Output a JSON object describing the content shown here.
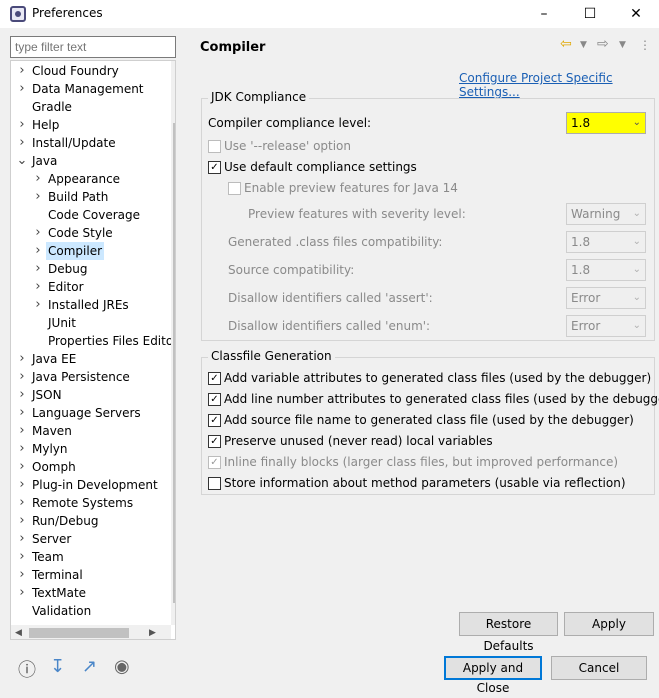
{
  "window": {
    "title": "Preferences",
    "icon": "preferences-icon",
    "controls": [
      "minimize",
      "maximize",
      "close"
    ]
  },
  "filter": {
    "placeholder": "type filter text"
  },
  "tree": [
    {
      "label": "Cloud Foundry",
      "indent": 0,
      "expander": ">"
    },
    {
      "label": "Data Management",
      "indent": 0,
      "expander": ">"
    },
    {
      "label": "Gradle",
      "indent": 0,
      "expander": ""
    },
    {
      "label": "Help",
      "indent": 0,
      "expander": ">"
    },
    {
      "label": "Install/Update",
      "indent": 0,
      "expander": ">"
    },
    {
      "label": "Java",
      "indent": 0,
      "expander": "v"
    },
    {
      "label": "Appearance",
      "indent": 1,
      "expander": ">"
    },
    {
      "label": "Build Path",
      "indent": 1,
      "expander": ">"
    },
    {
      "label": "Code Coverage",
      "indent": 1,
      "expander": ""
    },
    {
      "label": "Code Style",
      "indent": 1,
      "expander": ">"
    },
    {
      "label": "Compiler",
      "indent": 1,
      "expander": ">",
      "selected": true
    },
    {
      "label": "Debug",
      "indent": 1,
      "expander": ">"
    },
    {
      "label": "Editor",
      "indent": 1,
      "expander": ">"
    },
    {
      "label": "Installed JREs",
      "indent": 1,
      "expander": ">"
    },
    {
      "label": "JUnit",
      "indent": 1,
      "expander": ""
    },
    {
      "label": "Properties Files Edito",
      "indent": 1,
      "expander": ""
    },
    {
      "label": "Java EE",
      "indent": 0,
      "expander": ">"
    },
    {
      "label": "Java Persistence",
      "indent": 0,
      "expander": ">"
    },
    {
      "label": "JSON",
      "indent": 0,
      "expander": ">"
    },
    {
      "label": "Language Servers",
      "indent": 0,
      "expander": ">"
    },
    {
      "label": "Maven",
      "indent": 0,
      "expander": ">"
    },
    {
      "label": "Mylyn",
      "indent": 0,
      "expander": ">"
    },
    {
      "label": "Oomph",
      "indent": 0,
      "expander": ">"
    },
    {
      "label": "Plug-in Development",
      "indent": 0,
      "expander": ">"
    },
    {
      "label": "Remote Systems",
      "indent": 0,
      "expander": ">"
    },
    {
      "label": "Run/Debug",
      "indent": 0,
      "expander": ">"
    },
    {
      "label": "Server",
      "indent": 0,
      "expander": ">"
    },
    {
      "label": "Team",
      "indent": 0,
      "expander": ">"
    },
    {
      "label": "Terminal",
      "indent": 0,
      "expander": ">"
    },
    {
      "label": "TextMate",
      "indent": 0,
      "expander": ">"
    },
    {
      "label": "Validation",
      "indent": 0,
      "expander": ""
    }
  ],
  "page": {
    "title": "Compiler",
    "config_link": "Configure Project Specific Settings...",
    "jdk": {
      "group_label": "JDK Compliance",
      "compliance_label": "Compiler compliance level:",
      "compliance_value": "1.8",
      "release_label": "Use '--release' option",
      "release_checked": false,
      "default_label": "Use default compliance settings",
      "default_checked": true,
      "preview_label": "Enable preview features for Java 14",
      "preview_checked": false,
      "severity_label": "Preview features with severity level:",
      "severity_value": "Warning",
      "generated_label": "Generated .class files compatibility:",
      "generated_value": "1.8",
      "source_label": "Source compatibility:",
      "source_value": "1.8",
      "assert_label": "Disallow identifiers called 'assert':",
      "assert_value": "Error",
      "enum_label": "Disallow identifiers called 'enum':",
      "enum_value": "Error"
    },
    "classfile": {
      "group_label": "Classfile Generation",
      "options": [
        {
          "label": "Add variable attributes to generated class files (used by the debugger)",
          "checked": true,
          "enabled": true
        },
        {
          "label": "Add line number attributes to generated class files (used by the debugger)",
          "checked": true,
          "enabled": true
        },
        {
          "label": "Add source file name to generated class file (used by the debugger)",
          "checked": true,
          "enabled": true
        },
        {
          "label": "Preserve unused (never read) local variables",
          "checked": true,
          "enabled": true
        },
        {
          "label": "Inline finally blocks (larger class files, but improved performance)",
          "checked": true,
          "enabled": false
        },
        {
          "label": "Store information about method parameters (usable via reflection)",
          "checked": false,
          "enabled": true
        }
      ]
    },
    "restore_defaults": "Restore Defaults",
    "apply": "Apply"
  },
  "footer": {
    "apply_close": "Apply and Close",
    "cancel": "Cancel",
    "icons": [
      "help-icon",
      "import-icon",
      "export-icon",
      "record-icon"
    ]
  },
  "colors": {
    "highlight": "#ffff00",
    "link": "#1a5fb4",
    "selection": "#cce8ff",
    "default_button_border": "#0078d7"
  }
}
